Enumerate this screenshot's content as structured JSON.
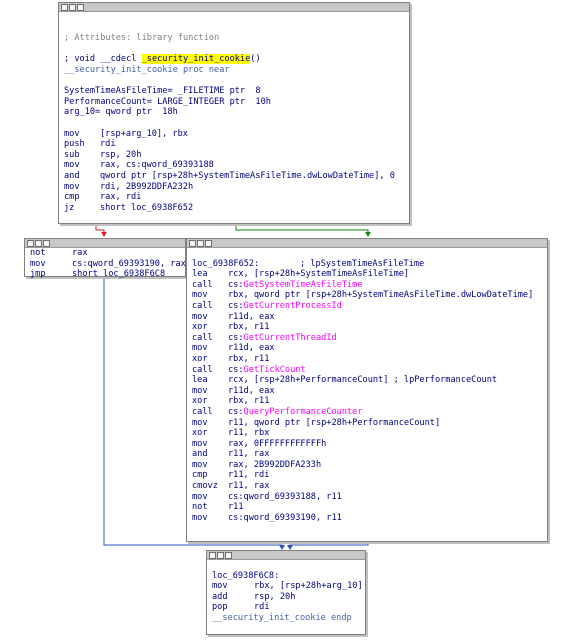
{
  "colors": {
    "true_edge": "#0b8a0b",
    "false_edge": "#d02020",
    "jump_edge": "#3050c0",
    "import_name": "#ff00ff",
    "highlight": "#ffff00",
    "comment": "#808080"
  },
  "icons": [
    "window-icon",
    "graph-icon",
    "text-icon"
  ],
  "top_block": {
    "comment_attr": "; Attributes: library function",
    "proto_prefix": "; void __cdecl ",
    "proto_name": "_security_init_cookie",
    "proto_suffix": "()",
    "proc_line": "__security_init_cookie proc near",
    "vars": [
      "SystemTimeAsFileTime= _FILETIME ptr  8",
      "PerformanceCount= LARGE_INTEGER ptr  10h",
      "arg_10= qword ptr  18h"
    ],
    "instr": [
      {
        "m": "mov",
        "o": "[rsp+arg_10], rbx"
      },
      {
        "m": "push",
        "o": "rdi"
      },
      {
        "m": "sub",
        "o": "rsp, 20h"
      },
      {
        "m": "mov",
        "o": "rax, cs:qword_69393188"
      },
      {
        "m": "and",
        "o": "qword ptr [rsp+28h+SystemTimeAsFileTime.dwLowDateTime], 0"
      },
      {
        "m": "mov",
        "o": "rdi, 2B992DDFA232h"
      },
      {
        "m": "cmp",
        "o": "rax, rdi"
      },
      {
        "m": "jz",
        "o": "short loc_6938F652"
      }
    ]
  },
  "left_block": {
    "instr": [
      {
        "m": "not",
        "o": "rax"
      },
      {
        "m": "mov",
        "o": "cs:qword_69393190, rax"
      },
      {
        "m": "jmp",
        "o": "short loc_6938F6C8"
      }
    ]
  },
  "right_block": {
    "label": "loc_6938F652:",
    "label_comment": "; lpSystemTimeAsFileTime",
    "instr": [
      {
        "m": "lea",
        "o": "rcx, [rsp+28h+SystemTimeAsFileTime]"
      },
      {
        "m": "call",
        "o": "cs:",
        "f": "GetSystemTimeAsFileTime"
      },
      {
        "m": "mov",
        "o": "rbx, qword ptr [rsp+28h+SystemTimeAsFileTime.dwLowDateTime]"
      },
      {
        "m": "call",
        "o": "cs:",
        "f": "GetCurrentProcessId"
      },
      {
        "m": "mov",
        "o": "r11d, eax"
      },
      {
        "m": "xor",
        "o": "rbx, r11"
      },
      {
        "m": "call",
        "o": "cs:",
        "f": "GetCurrentThreadId"
      },
      {
        "m": "mov",
        "o": "r11d, eax"
      },
      {
        "m": "xor",
        "o": "rbx, r11"
      },
      {
        "m": "call",
        "o": "cs:",
        "f": "GetTickCount"
      },
      {
        "m": "lea",
        "o": "rcx, [rsp+28h+PerformanceCount] ; lpPerformanceCount"
      },
      {
        "m": "mov",
        "o": "r11d, eax"
      },
      {
        "m": "xor",
        "o": "rbx, r11"
      },
      {
        "m": "call",
        "o": "cs:",
        "f": "QueryPerformanceCounter"
      },
      {
        "m": "mov",
        "o": "r11, qword ptr [rsp+28h+PerformanceCount]"
      },
      {
        "m": "xor",
        "o": "r11, rbx"
      },
      {
        "m": "mov",
        "o": "rax, 0FFFFFFFFFFFFh"
      },
      {
        "m": "and",
        "o": "r11, rax"
      },
      {
        "m": "mov",
        "o": "rax, 2B992DDFA233h"
      },
      {
        "m": "cmp",
        "o": "r11, rdi"
      },
      {
        "m": "cmovz",
        "o": "r11, rax"
      },
      {
        "m": "mov",
        "o": "cs:qword_69393188, r11"
      },
      {
        "m": "not",
        "o": "r11"
      },
      {
        "m": "mov",
        "o": "cs:qword_69393190, r11"
      }
    ]
  },
  "bottom_block": {
    "label": "loc_6938F6C8:",
    "instr": [
      {
        "m": "mov",
        "o": "rbx, [rsp+28h+arg_10]"
      },
      {
        "m": "add",
        "o": "rsp, 20h"
      },
      {
        "m": "pop",
        "o": "rdi"
      }
    ],
    "endp": "__security_init_cookie endp"
  }
}
